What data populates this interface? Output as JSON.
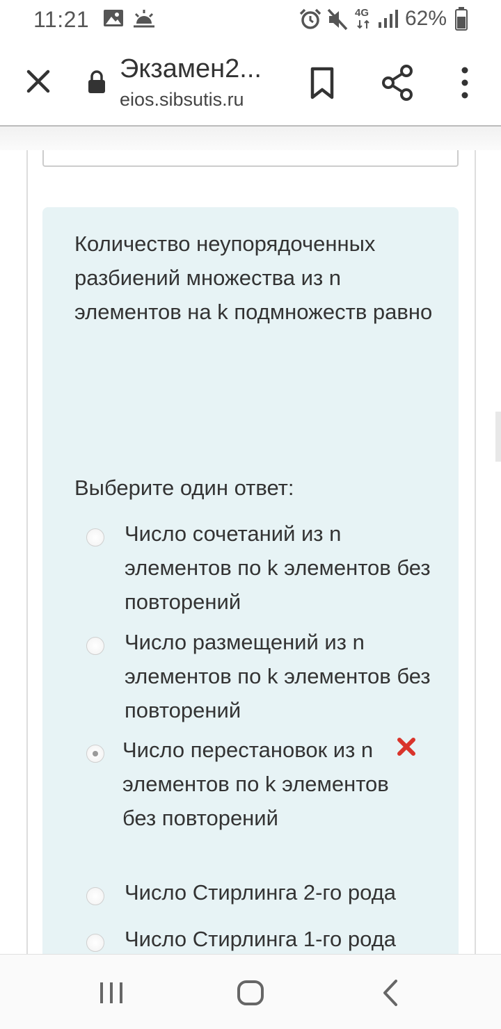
{
  "status_bar": {
    "time": "11:21",
    "network": "4G",
    "battery": "62%",
    "icons": [
      "gallery-icon",
      "weather-icon",
      "alarm-icon",
      "mute-icon",
      "signal-icon",
      "battery-icon"
    ]
  },
  "toolbar": {
    "title": "Экзамен2...",
    "url": "eios.sibsutis.ru",
    "icons": [
      "close-icon",
      "lock-icon",
      "bookmark-icon",
      "share-icon",
      "more-icon"
    ]
  },
  "question": {
    "text": "Количество неупорядоченных разбиений множества из n элементов на k подмножеств равно",
    "prompt": "Выберите один ответ:",
    "answers": [
      {
        "label": "Число сочетаний из n элементов по k элементов без повторений",
        "selected": false
      },
      {
        "label": "Число размещений из n элементов по k элементов без повторений",
        "selected": false
      },
      {
        "label": "Число перестановок из n элементов по k элементов без повторений",
        "selected": true,
        "marked_wrong": true
      },
      {
        "label": "Число Стирлинга 2-го рода",
        "selected": false
      },
      {
        "label": "Число Стирлинга 1-го рода",
        "selected": false
      }
    ]
  },
  "colors": {
    "card_background": "#e7f3f5",
    "wrong_mark": "#d9342b",
    "text": "#333333"
  },
  "nav_bar": {
    "icons": [
      "recent-apps-icon",
      "home-icon",
      "back-icon"
    ]
  }
}
